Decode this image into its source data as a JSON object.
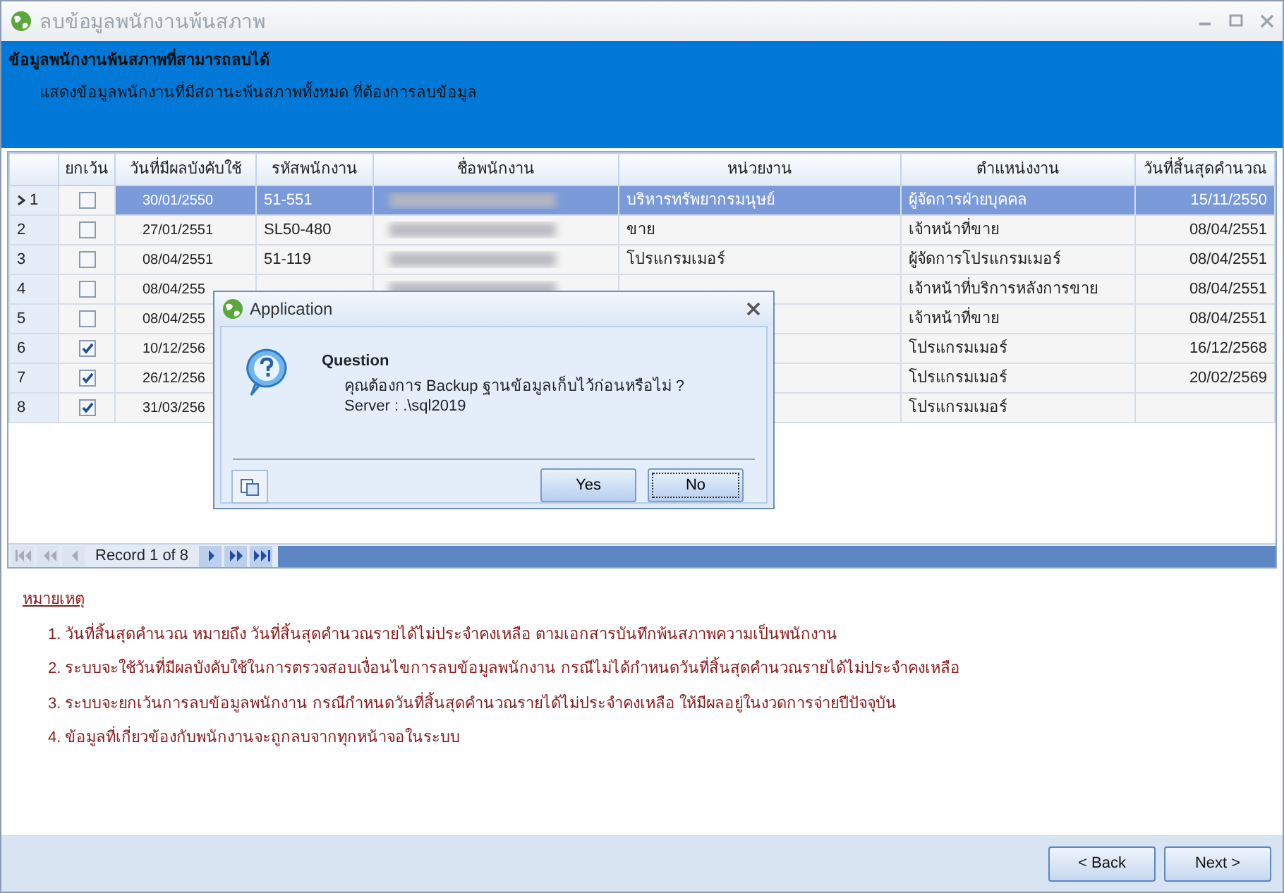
{
  "window": {
    "title": "ลบข้อมูลพนักงานพ้นสภาพ"
  },
  "header": {
    "title": "ข้อมูลพนักงานพ้นสภาพที่สามารถลบได้",
    "subtitle": "แสดงข้อมูลพนักงานที่มีสถานะพ้นสภาพทั้งหมด ที่ต้องการลบข้อมูล"
  },
  "table": {
    "columns": [
      "ยกเว้น",
      "วันที่มีผลบังคับใช้",
      "รหัสพนักงาน",
      "ชื่อพนักงาน",
      "หน่วยงาน",
      "ตำแหน่งงาน",
      "วันที่สิ้นสุดคำนวณ"
    ],
    "rows": [
      {
        "row_number": "1",
        "current": true,
        "selected": true,
        "checked": false,
        "effective_date": "30/01/2550",
        "employee_code": "51-551",
        "name_blurred": true,
        "department": "บริหารทรัพยากรมนุษย์",
        "position": "ผู้จัดการฝ่ายบุคคล",
        "end_date": "15/11/2550"
      },
      {
        "row_number": "2",
        "current": false,
        "selected": false,
        "checked": false,
        "effective_date": "27/01/2551",
        "employee_code": "SL50-480",
        "name_blurred": true,
        "department": "ขาย",
        "position": "เจ้าหน้าที่ขาย",
        "end_date": "08/04/2551"
      },
      {
        "row_number": "3",
        "current": false,
        "selected": false,
        "checked": false,
        "effective_date": "08/04/2551",
        "employee_code": "51-119",
        "name_blurred": true,
        "department": "โปรแกรมเมอร์",
        "position": "ผู้จัดการโปรแกรมเมอร์",
        "end_date": "08/04/2551"
      },
      {
        "row_number": "4",
        "current": false,
        "selected": false,
        "checked": false,
        "effective_date": "08/04/255",
        "name_blurred": true,
        "position": "เจ้าหน้าที่บริการหลังการขาย",
        "end_date": "08/04/2551"
      },
      {
        "row_number": "5",
        "current": false,
        "selected": false,
        "checked": false,
        "effective_date": "08/04/255",
        "position": "เจ้าหน้าที่ขาย",
        "end_date": "08/04/2551"
      },
      {
        "row_number": "6",
        "current": false,
        "selected": false,
        "checked": true,
        "effective_date": "10/12/256",
        "position": "โปรแกรมเมอร์",
        "end_date": "16/12/2568"
      },
      {
        "row_number": "7",
        "current": false,
        "selected": false,
        "checked": true,
        "effective_date": "26/12/256",
        "position": "โปรแกรมเมอร์",
        "end_date": "20/02/2569"
      },
      {
        "row_number": "8",
        "current": false,
        "selected": false,
        "checked": true,
        "effective_date": "31/03/256",
        "position": "โปรแกรมเมอร์"
      }
    ]
  },
  "navigator": {
    "record": "Record 1 of 8",
    "buttons": [
      {
        "kind": "first",
        "disabled": true
      },
      {
        "kind": "prev-page",
        "disabled": true
      },
      {
        "kind": "prev",
        "disabled": true
      },
      {
        "kind": "next",
        "disabled": false
      },
      {
        "kind": "next-page",
        "disabled": false
      },
      {
        "kind": "last",
        "disabled": false
      }
    ]
  },
  "notes": {
    "title": "หมายเหตุ",
    "items": [
      "1. วันที่สิ้นสุดคำนวณ หมายถึง วันที่สิ้นสุดคำนวณรายได้ไม่ประจำคงเหลือ ตามเอกสารบันทึกพ้นสภาพความเป็นพนักงาน",
      "2. ระบบจะใช้วันที่มีผลบังคับใช้ในการตรวจสอบเงื่อนไขการลบข้อมูลพนักงาน กรณีไม่ได้กำหนดวันที่สิ้นสุดคำนวณรายได้ไม่ประจำคงเหลือ",
      "3. ระบบจะยกเว้นการลบข้อมูลพนักงาน กรณีกำหนดวันที่สิ้นสุดคำนวณรายได้ไม่ประจำคงเหลือ ให้มีผลอยู่ในงวดการจ่ายปีปัจจุบัน",
      "4. ข้อมูลที่เกี่ยวข้องกับพนักงานจะถูกลบจากทุกหน้าจอในระบบ"
    ]
  },
  "footer_buttons": [
    "< Back",
    "Next >"
  ],
  "dialog": {
    "title": "Application",
    "heading": "Question",
    "message": "คุณต้องการ Backup ฐานข้อมูลเก็บไว้ก่อนหรือไม่ ?",
    "server": "Server : .\\sql2019",
    "buttons": [
      {
        "label": "Yes",
        "focused": false
      },
      {
        "label": "No",
        "focused": true
      }
    ]
  }
}
